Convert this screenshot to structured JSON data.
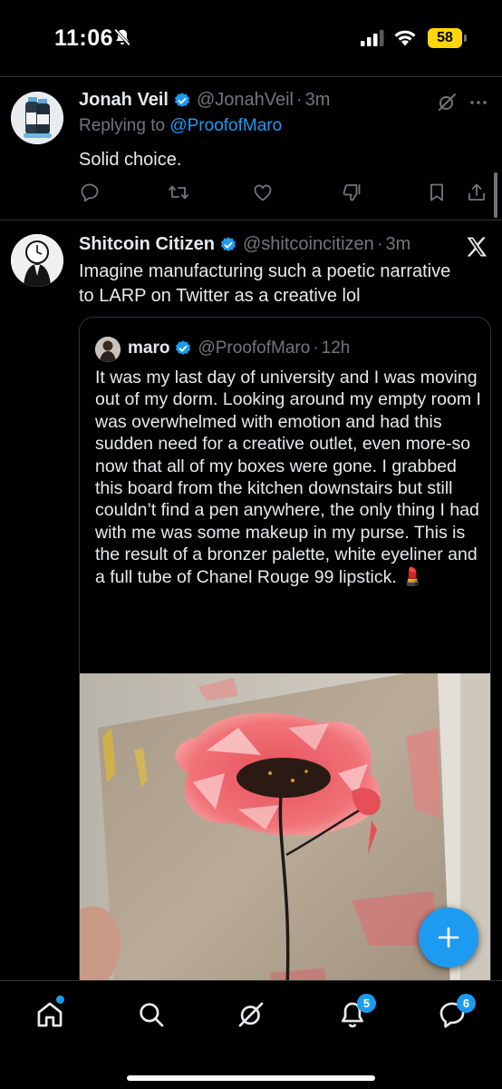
{
  "status_bar": {
    "time": "11:06",
    "battery": "58",
    "battery_color": "#ffd60a"
  },
  "reply_tweet": {
    "display_name": "Jonah Veil",
    "handle": "@JonahVeil",
    "time": "3m",
    "replying_prefix": "Replying to",
    "replying_to": "@ProofofMaro",
    "text": "Solid choice.",
    "icons": [
      "reply-icon",
      "retweet-icon",
      "like-icon",
      "dislike-icon",
      "bookmark-icon",
      "share-icon"
    ]
  },
  "main_tweet": {
    "display_name": "Shitcoin Citizen",
    "handle": "@shitcoincitizen",
    "time": "3m",
    "text_line1": "Imagine manufacturing such a poetic narrative",
    "text_line2": "to LARP on Twitter as a creative lol"
  },
  "quoted_tweet": {
    "display_name": "maro",
    "handle": "@ProofofMaro",
    "time": "12h",
    "text": "It was my last day of university and I was moving out of my dorm. Looking around my empty room I was overwhelmed with emotion and had this sudden need for a creative outlet, even more-so now that all of my boxes were gone. I grabbed this board from the kitchen downstairs but still couldn’t find a pen anywhere, the only thing I had with me was some makeup in my purse. This is the result of a bronzer palette, white eyeliner and a full tube of Chanel Rouge 99 lipstick. 💄"
  },
  "bottom_nav": {
    "items": [
      "home-icon",
      "search-icon",
      "grok-icon",
      "notifications-icon",
      "messages-icon"
    ],
    "notifications_count": "5",
    "messages_count": "6"
  },
  "colors": {
    "accent": "#1d9bf0",
    "background": "#000000",
    "text": "#e7e9ea",
    "muted": "#71767b",
    "divider": "#2f3336"
  }
}
